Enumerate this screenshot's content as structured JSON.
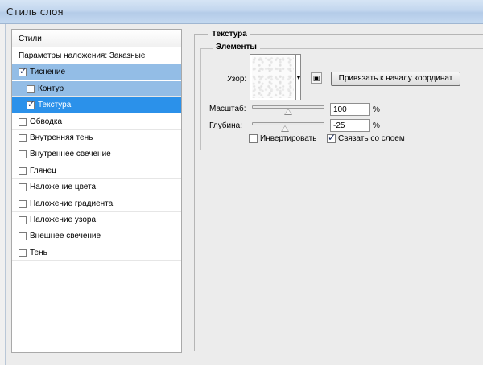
{
  "window": {
    "title": "Стиль слоя"
  },
  "styles": {
    "header": "Стили",
    "items": [
      {
        "label": "Параметры наложения: Заказные",
        "checkbox": false,
        "checked": false,
        "indent": 0,
        "state": "normal"
      },
      {
        "label": "Тиснение",
        "checkbox": true,
        "checked": true,
        "indent": 0,
        "state": "selected-parent"
      },
      {
        "label": "Контур",
        "checkbox": true,
        "checked": false,
        "indent": 1,
        "state": "selected-parent"
      },
      {
        "label": "Текстура",
        "checkbox": true,
        "checked": true,
        "indent": 1,
        "state": "selected"
      },
      {
        "label": "Обводка",
        "checkbox": true,
        "checked": false,
        "indent": 0,
        "state": "normal"
      },
      {
        "label": "Внутренняя тень",
        "checkbox": true,
        "checked": false,
        "indent": 0,
        "state": "normal"
      },
      {
        "label": "Внутреннее свечение",
        "checkbox": true,
        "checked": false,
        "indent": 0,
        "state": "normal"
      },
      {
        "label": "Глянец",
        "checkbox": true,
        "checked": false,
        "indent": 0,
        "state": "normal"
      },
      {
        "label": "Наложение цвета",
        "checkbox": true,
        "checked": false,
        "indent": 0,
        "state": "normal"
      },
      {
        "label": "Наложение градиента",
        "checkbox": true,
        "checked": false,
        "indent": 0,
        "state": "normal"
      },
      {
        "label": "Наложение узора",
        "checkbox": true,
        "checked": false,
        "indent": 0,
        "state": "normal"
      },
      {
        "label": "Внешнее свечение",
        "checkbox": true,
        "checked": false,
        "indent": 0,
        "state": "normal"
      },
      {
        "label": "Тень",
        "checkbox": true,
        "checked": false,
        "indent": 0,
        "state": "normal"
      }
    ]
  },
  "texture": {
    "group_title": "Текстура",
    "elements_title": "Элементы",
    "pattern_label": "Узор:",
    "snap_button": "Привязать к началу координат",
    "scale": {
      "label": "Масштаб:",
      "value": "100",
      "unit": "%",
      "slider_fraction": 0.49
    },
    "depth": {
      "label": "Глубина:",
      "value": "-25",
      "unit": "%",
      "slider_fraction": 0.44
    },
    "invert": {
      "label": "Инвертировать",
      "checked": false
    },
    "link": {
      "label": "Связать со слоем",
      "checked": true
    }
  },
  "colors": {
    "selected": "#2b91ea",
    "selected_parent": "#93bde6"
  },
  "icons": {
    "pattern_dropdown": "triangle-down-icon",
    "new_preset": "new-preset-icon"
  }
}
